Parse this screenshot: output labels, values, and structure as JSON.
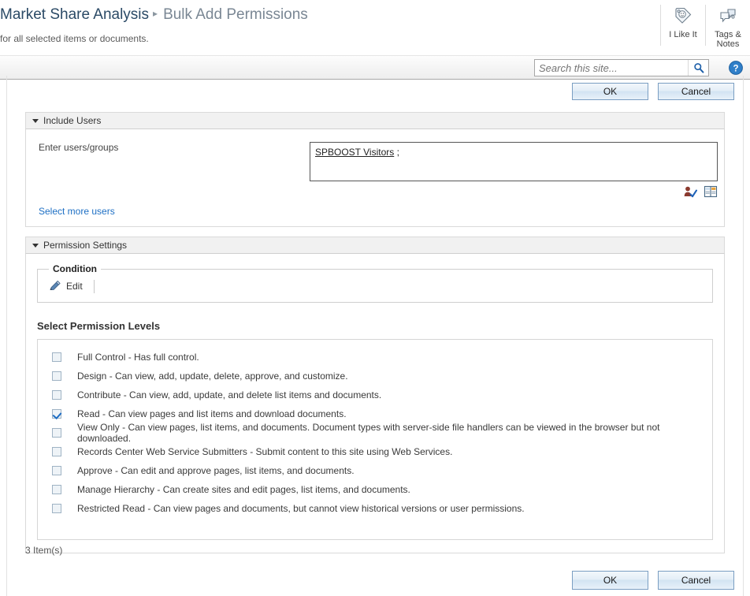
{
  "header": {
    "breadcrumb_site": "Market Share Analysis",
    "breadcrumb_separator": "▸",
    "breadcrumb_page": "Bulk Add Permissions",
    "subtitle": "for all selected items or documents.",
    "tools": [
      {
        "label": "I Like It",
        "icon": "like-tag-icon"
      },
      {
        "label": "Tags &\nNotes",
        "icon": "tags-notes-icon"
      }
    ]
  },
  "search": {
    "placeholder": "Search this site...",
    "value": "",
    "icon": "search-icon",
    "help_icon": "help-icon"
  },
  "actions": {
    "ok_label": "OK",
    "cancel_label": "Cancel"
  },
  "include_users": {
    "section_title": "Include Users",
    "field_label": "Enter users/groups",
    "entry": "SPBOOST Visitors",
    "entry_separator": ";",
    "check_names_icon": "check-names-icon",
    "address_book_icon": "address-book-icon",
    "select_more_label": "Select more users"
  },
  "permission_settings": {
    "section_title": "Permission Settings",
    "condition_legend": "Condition",
    "edit_label": "Edit",
    "edit_icon": "pencil-icon",
    "levels_title": "Select Permission Levels",
    "levels": [
      {
        "label": "Full Control - Has full control.",
        "checked": false
      },
      {
        "label": "Design - Can view, add, update, delete, approve, and customize.",
        "checked": false
      },
      {
        "label": "Contribute - Can view, add, update, and delete list items and documents.",
        "checked": false
      },
      {
        "label": "Read - Can view pages and list items and download documents.",
        "checked": true
      },
      {
        "label": "View Only - Can view pages, list items, and documents. Document types with server-side file handlers can be viewed in the browser but not downloaded.",
        "checked": false
      },
      {
        "label": "Records Center Web Service Submitters - Submit content to this site using Web Services.",
        "checked": false
      },
      {
        "label": "Approve - Can edit and approve pages, list items, and documents.",
        "checked": false
      },
      {
        "label": "Manage Hierarchy - Can create sites and edit pages, list items, and documents.",
        "checked": false
      },
      {
        "label": "Restricted Read - Can view pages and documents, but cannot view historical versions or user permissions.",
        "checked": false
      }
    ]
  },
  "status": {
    "item_count": "3 Item(s)"
  },
  "colors": {
    "accent": "#1d6fc4",
    "breadcrumb": "#2b4a66",
    "button_border": "#7a9ec2"
  }
}
